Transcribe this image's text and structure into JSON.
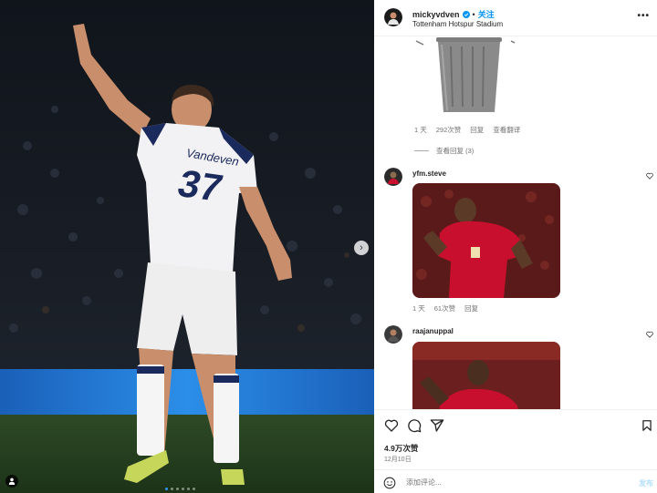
{
  "media": {
    "jersey_name": "Vandeven",
    "jersey_number": "37",
    "carousel_dots": 6,
    "active_dot": 0,
    "next_icon": "chevron-right-icon",
    "tag_icon": "person-icon"
  },
  "header": {
    "username": "mickyvdven",
    "separator": "•",
    "follow_label": "关注",
    "location": "Tottenham Hotspur Stadium",
    "more_label": "•••"
  },
  "comments": {
    "first": {
      "time": "1 天",
      "likes": "292次赞",
      "reply": "回复",
      "translate": "查看翻译",
      "view_replies": "查看回复 (3)"
    },
    "items": [
      {
        "username": "yfm.steve",
        "time": "1 天",
        "likes": "61次赞",
        "reply": "回复"
      },
      {
        "username": "raajanuppal"
      }
    ]
  },
  "actions": {
    "like_icon": "heart-icon",
    "comment_icon": "comment-icon",
    "share_icon": "send-icon",
    "save_icon": "bookmark-icon",
    "likes_text": "4.9万次赞",
    "date": "12月10日"
  },
  "add_comment": {
    "emoji_icon": "smiley-icon",
    "placeholder": "添加评论...",
    "post_label": "发布"
  },
  "colors": {
    "accent": "#0095f6",
    "post_disabled": "#b2dffc",
    "liverpool_red": "#c8102e"
  }
}
